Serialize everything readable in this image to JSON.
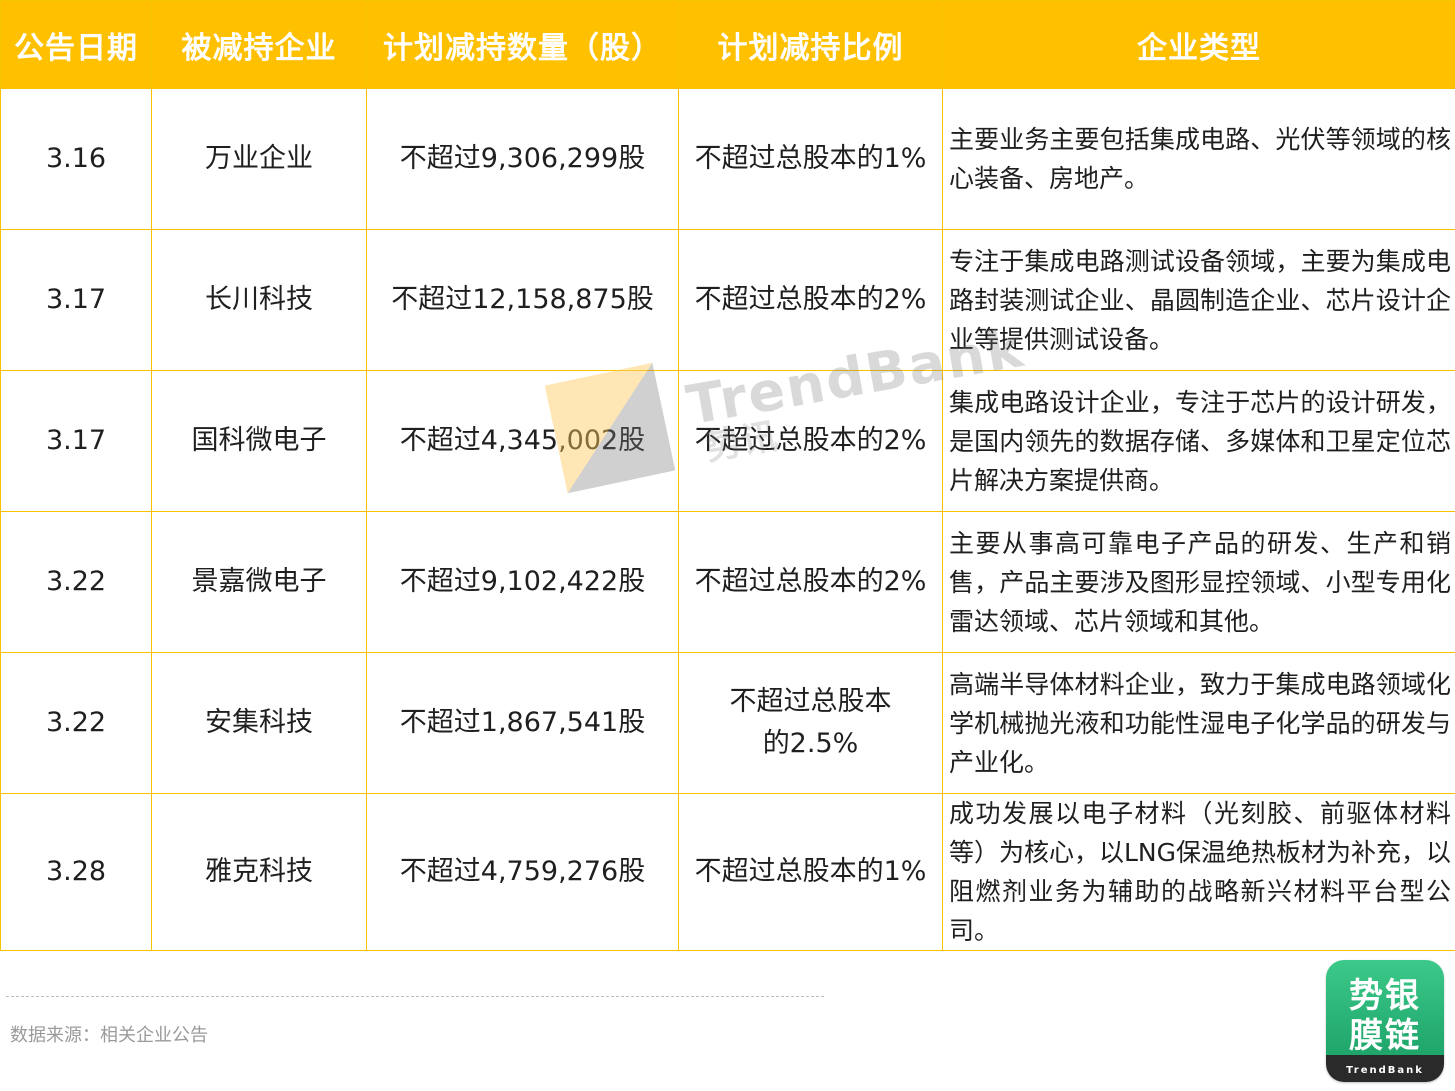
{
  "table": {
    "headers": [
      "公告日期",
      "被减持企业",
      "计划减持数量（股）",
      "计划减持比例",
      "企业类型"
    ],
    "rows": [
      {
        "date": "3.16",
        "company": "万业企业",
        "shares": "不超过9,306,299股",
        "ratio": "不超过总股本的1%",
        "type": "主要业务主要包括集成电路、光伏等领域的核心装备、房地产。"
      },
      {
        "date": "3.17",
        "company": "长川科技",
        "shares": "不超过12,158,875股",
        "ratio": "不超过总股本的2%",
        "type": "专注于集成电路测试设备领域，主要为集成电路封装测试企业、晶圆制造企业、芯片设计企业等提供测试设备。"
      },
      {
        "date": "3.17",
        "company": "国科微电子",
        "shares": "不超过4,345,002股",
        "ratio": "不超过总股本的2%",
        "type": "集成电路设计企业，专注于芯片的设计研发，是国内领先的数据存储、多媒体和卫星定位芯片解决方案提供商。"
      },
      {
        "date": "3.22",
        "company": "景嘉微电子",
        "shares": "不超过9,102,422股",
        "ratio": "不超过总股本的2%",
        "type": "主要从事高可靠电子产品的研发、生产和销售，产品主要涉及图形显控领域、小型专用化雷达领域、芯片领域和其他。"
      },
      {
        "date": "3.22",
        "company": "安集科技",
        "shares": "不超过1,867,541股",
        "ratio": "不超过总股本的2.5%",
        "type": "高端半导体材料企业，致力于集成电路领域化学机械抛光液和功能性湿电子化学品的研发与产业化。"
      },
      {
        "date": "3.28",
        "company": "雅克科技",
        "shares": "不超过4,759,276股",
        "ratio": "不超过总股本的1%",
        "type": "成功发展以电子材料（光刻胶、前驱体材料等）为核心，以LNG保温绝热板材为补充，以阻燃剂业务为辅助的战略新兴材料平台型公司。"
      }
    ]
  },
  "watermark": {
    "text": "TrendBank",
    "sub": "势讯"
  },
  "footer": {
    "source": "数据来源：相关企业公告"
  },
  "logo": {
    "line1": "势银",
    "line2": "膜链",
    "foot": "TrendBank"
  },
  "colors": {
    "header_bg": "#ffc000",
    "border": "#f5c200",
    "logo_green": "#1fa56a"
  }
}
